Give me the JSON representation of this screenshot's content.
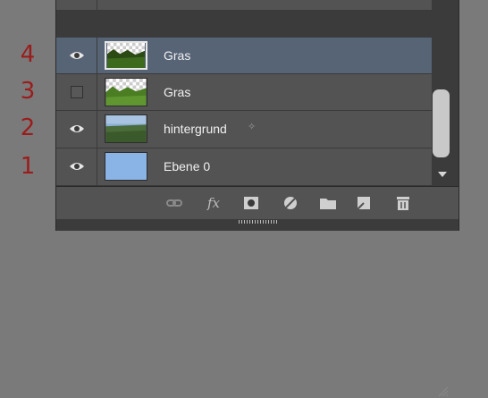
{
  "row_numbers": [
    "4",
    "3",
    "2",
    "1"
  ],
  "layers": [
    {
      "name": "Gras",
      "visible": true,
      "selected": true,
      "thumbnail": "grass-transparent-top"
    },
    {
      "name": "Gras",
      "visible": false,
      "selected": false,
      "thumbnail": "grass-transparent-top"
    },
    {
      "name": "hintergrund",
      "visible": true,
      "selected": false,
      "thumbnail": "landscape-sky-grass",
      "badge_icon": "sparkle-icon"
    },
    {
      "name": "Ebene 0",
      "visible": true,
      "selected": false,
      "thumbnail": "solid-blue"
    }
  ],
  "toolbar": {
    "icons": [
      "link-icon",
      "fx-icon",
      "mask-icon",
      "adjustment-icon",
      "folder-icon",
      "new-layer-icon",
      "trash-icon"
    ],
    "fx_label": "fx"
  },
  "colors": {
    "background": "#7a7a7a",
    "panel": "#535353",
    "selected_row": "#566476",
    "row_number_red": "#9b1c1c",
    "label_text": "#f0f0f0"
  }
}
